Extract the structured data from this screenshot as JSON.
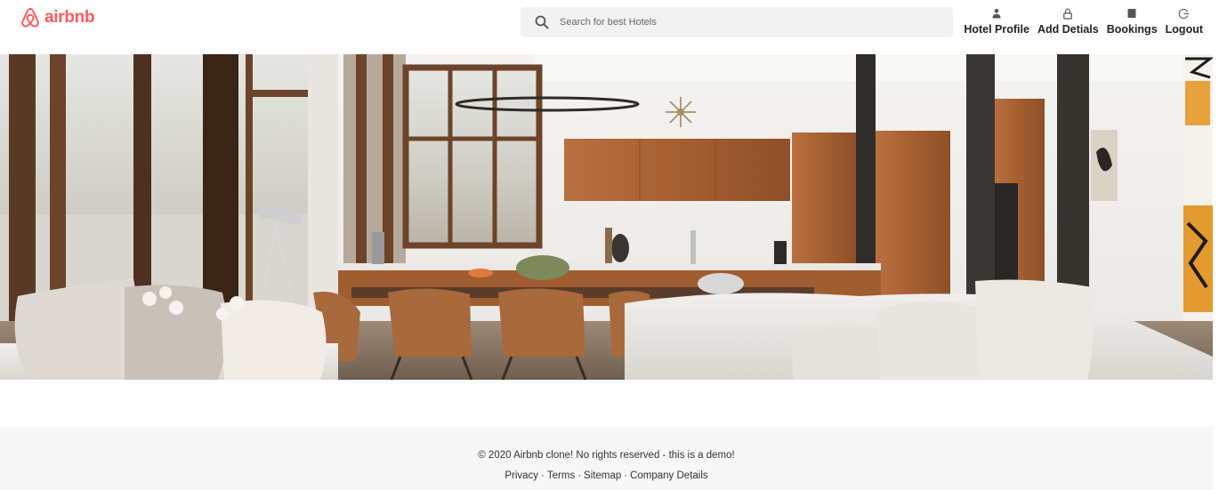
{
  "header": {
    "brand": "airbnb",
    "search": {
      "placeholder": "Search for best Hotels",
      "value": ""
    },
    "nav": [
      {
        "label": "Hotel Profile",
        "icon": "user-icon"
      },
      {
        "label": "Add Detials",
        "icon": "lock-icon"
      },
      {
        "label": "Bookings",
        "icon": "book-icon"
      },
      {
        "label": "Logout",
        "icon": "logout-icon"
      }
    ]
  },
  "hero": {
    "image": "modern living room with kitchen"
  },
  "footer": {
    "copyright": "© 2020 Airbnb clone! No rights reserved - this is a demo!",
    "links": [
      "Privacy",
      "Terms",
      "Sitemap",
      "Company Details"
    ],
    "separator": "·"
  },
  "colors": {
    "brand": "#ff5a5f",
    "search_bg": "#f2f2f2",
    "footer_bg": "#f7f7f7"
  }
}
